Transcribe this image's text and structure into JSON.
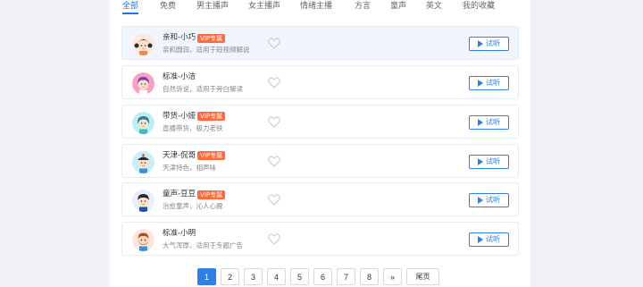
{
  "tabs": [
    {
      "label": "全部",
      "active": true
    },
    {
      "label": "免费",
      "active": false
    },
    {
      "label": "男主播声",
      "active": false
    },
    {
      "label": "女主播声",
      "active": false
    },
    {
      "label": "情绪主播",
      "active": false
    },
    {
      "label": "方言",
      "active": false
    },
    {
      "label": "童声",
      "active": false
    },
    {
      "label": "英文",
      "active": false
    },
    {
      "label": "我的收藏",
      "active": false
    }
  ],
  "voices": [
    {
      "name": "亲和-小巧",
      "vip": "VIP专属",
      "desc": "亲和圆润，适用于短视频解说",
      "avatar": "girl-pigtails-avatar",
      "selected": true,
      "try_label": "试听"
    },
    {
      "name": "标准-小洁",
      "vip": "",
      "desc": "自然诉说，适用于旁白解读",
      "avatar": "girl-purple-avatar",
      "selected": false,
      "try_label": "试听"
    },
    {
      "name": "带货-小娅",
      "vip": "VIP专属",
      "desc": "直播带货，极力老铁",
      "avatar": "girl-teal-avatar",
      "selected": false,
      "try_label": "试听"
    },
    {
      "name": "天津-侃哥",
      "vip": "VIP专属",
      "desc": "天津特色，相声味",
      "avatar": "man-cap-avatar",
      "selected": false,
      "try_label": "试听"
    },
    {
      "name": "童声-豆豆",
      "vip": "VIP专属",
      "desc": "治愈童声，沁人心脾",
      "avatar": "boy-avatar",
      "selected": false,
      "try_label": "试听"
    },
    {
      "name": "标准-小明",
      "vip": "",
      "desc": "大气浑厚，适用于专题广告",
      "avatar": "man-beard-avatar",
      "selected": false,
      "try_label": "试听"
    }
  ],
  "pagination": {
    "pages": [
      "1",
      "2",
      "3",
      "4",
      "5",
      "6",
      "7",
      "8"
    ],
    "current": "1",
    "next": "»",
    "last": "尾页"
  },
  "colors": {
    "accent": "#2f7fe6",
    "vip": "#ff6a3d",
    "selected_row": "#f1f5fe"
  }
}
